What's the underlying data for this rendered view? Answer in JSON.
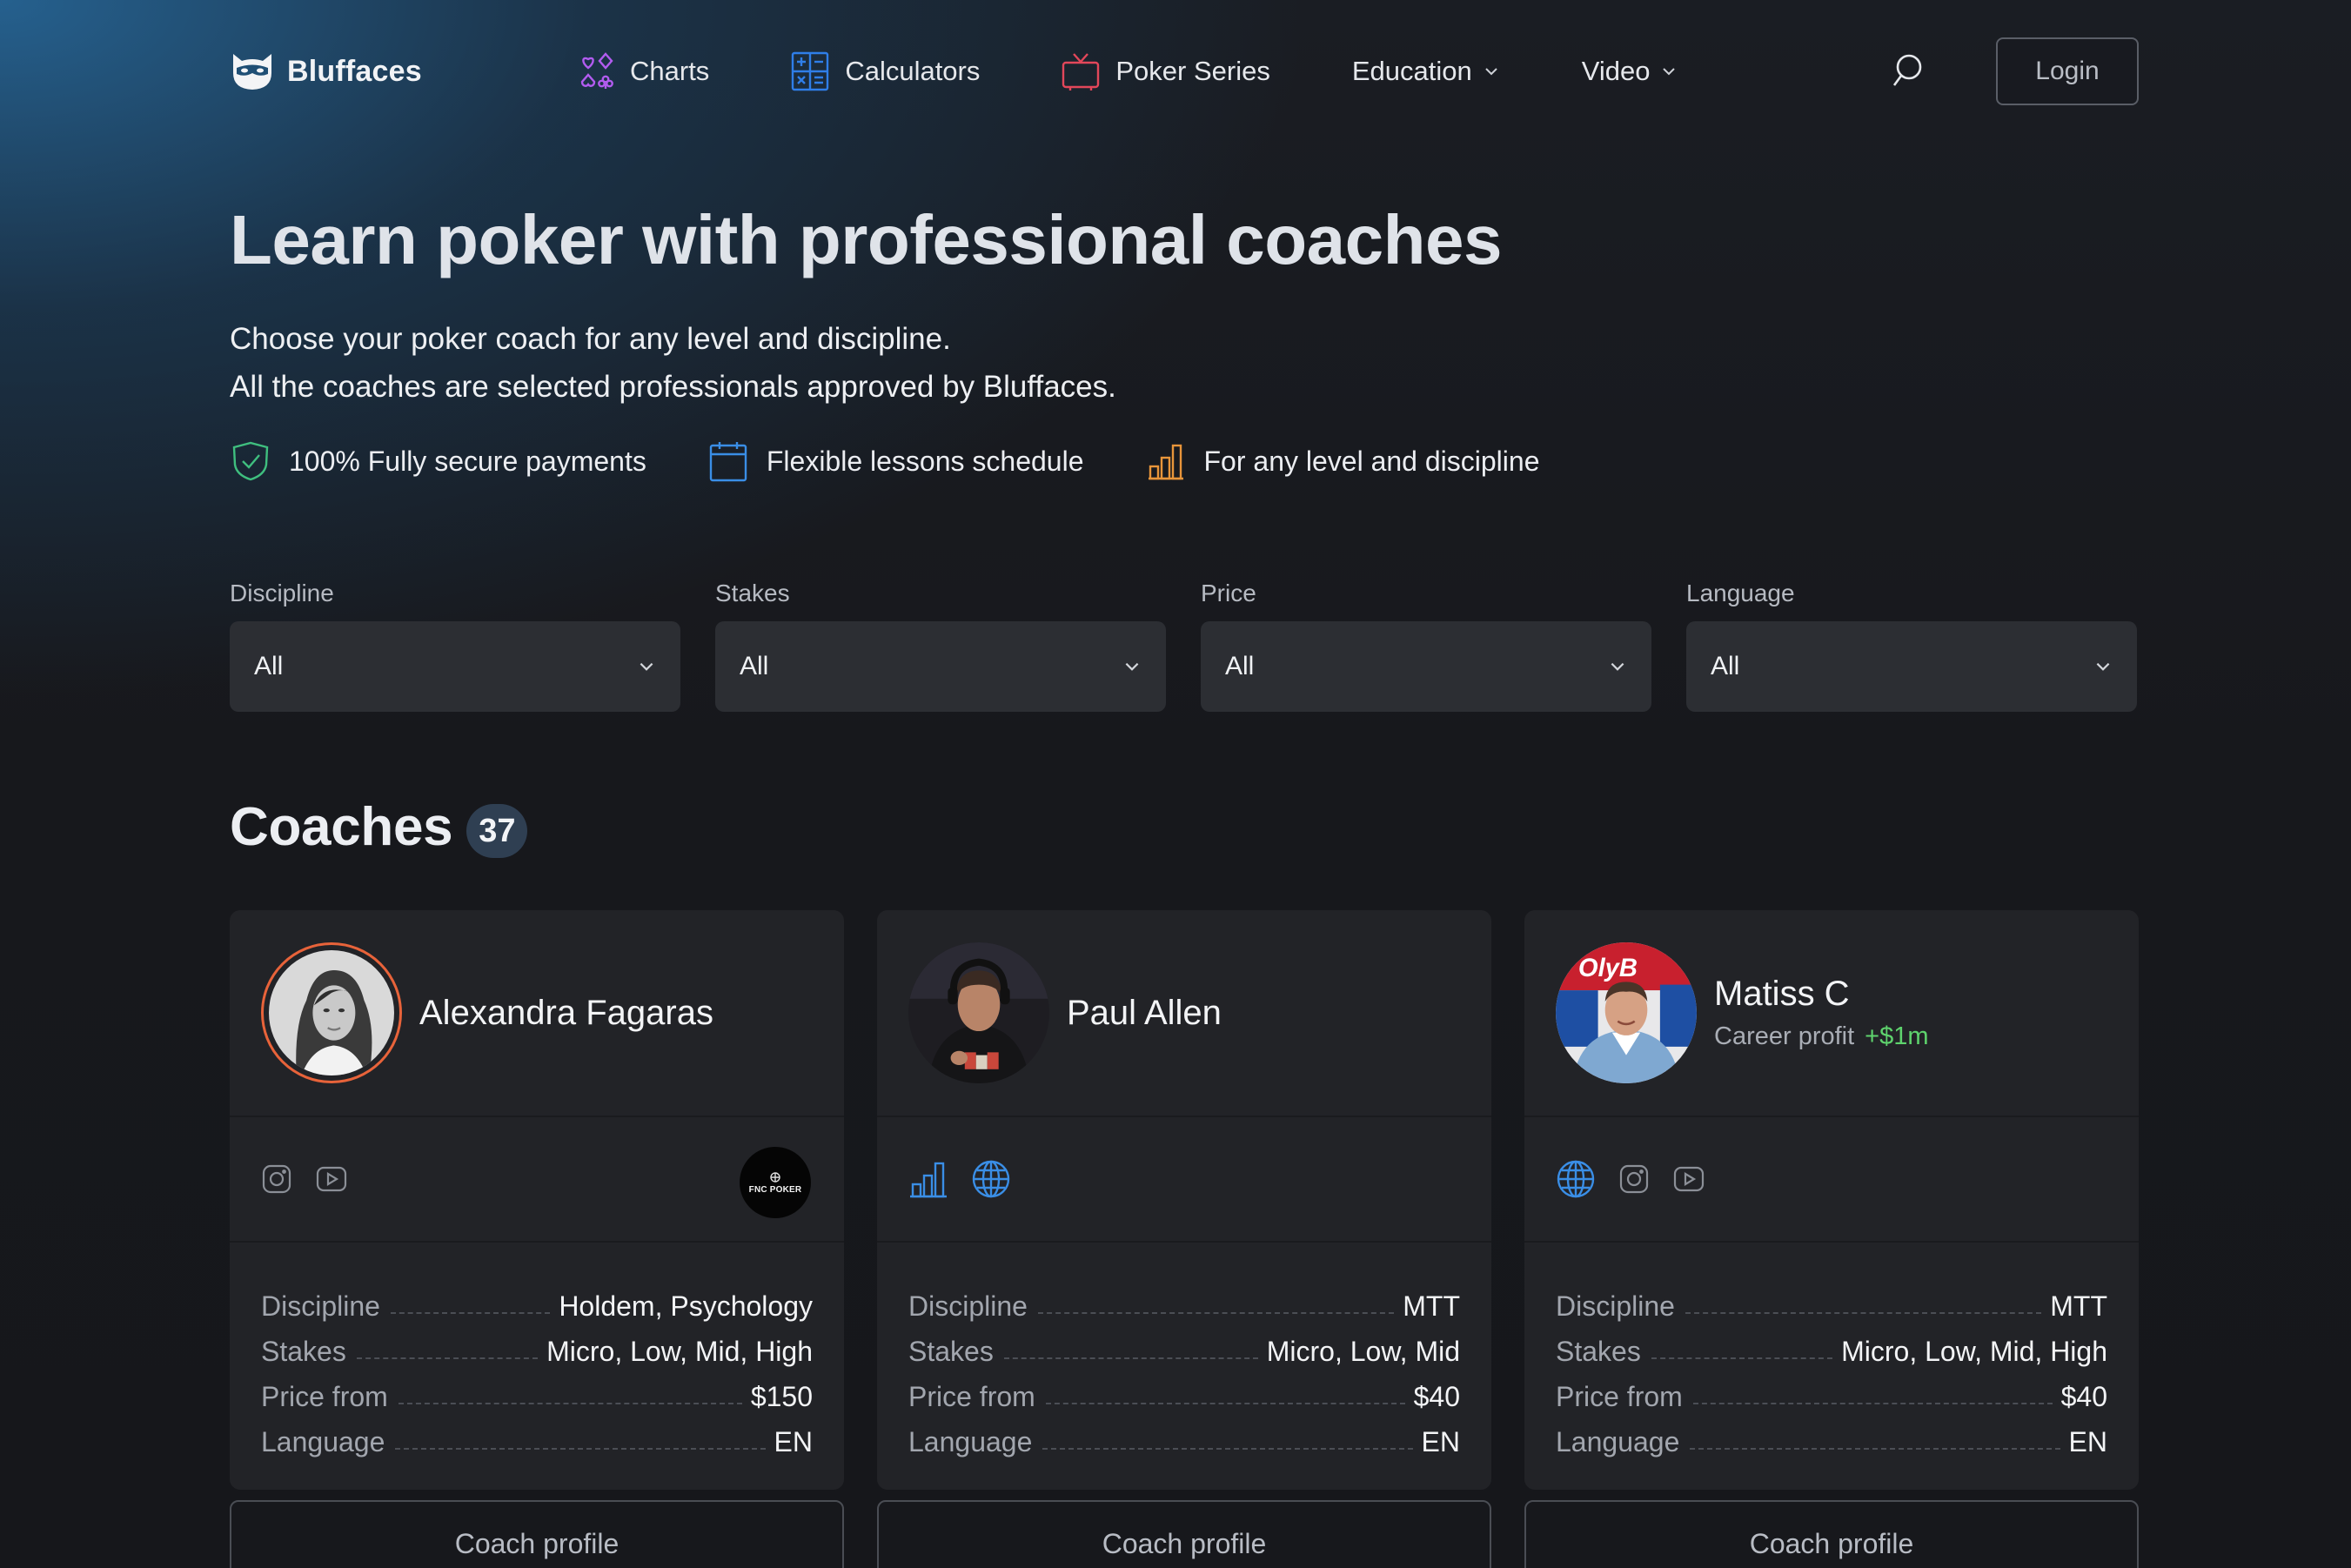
{
  "brand": {
    "name": "Bluffaces",
    "icon": "mask-icon"
  },
  "nav": {
    "items": [
      {
        "label": "Charts",
        "icon": "cards-suits-icon",
        "color": "#b25cf0"
      },
      {
        "label": "Calculators",
        "icon": "calculator-icon",
        "color": "#2f7ee8"
      },
      {
        "label": "Poker Series",
        "icon": "tv-icon",
        "color": "#e2475a"
      },
      {
        "label": "Education",
        "icon": "chevron-down-icon"
      },
      {
        "label": "Video",
        "icon": "chevron-down-icon"
      }
    ],
    "search_icon": "search-icon",
    "login_label": "Login"
  },
  "hero": {
    "title": "Learn poker with professional coaches",
    "subtitle_line1": "Choose your poker coach for any level and discipline.",
    "subtitle_line2": "All the coaches are selected professionals approved by Bluffaces.",
    "features": [
      {
        "label": "100% Fully secure payments",
        "icon": "shield-check-icon",
        "color": "#3fbf7f"
      },
      {
        "label": "Flexible lessons schedule",
        "icon": "calendar-icon",
        "color": "#3a8ee6"
      },
      {
        "label": "For any level and discipline",
        "icon": "bar-chart-icon",
        "color": "#e8953a"
      }
    ]
  },
  "filters": [
    {
      "label": "Discipline",
      "value": "All"
    },
    {
      "label": "Stakes",
      "value": "All"
    },
    {
      "label": "Price",
      "value": "All"
    },
    {
      "label": "Language",
      "value": "All"
    }
  ],
  "coaches": {
    "title": "Coaches",
    "count": "37",
    "cards": [
      {
        "name": "Alexandra Fagaras",
        "career_label": "",
        "career_profit": "",
        "social": [
          "instagram-icon",
          "youtube-icon"
        ],
        "sponsor_text": "FNC POKER",
        "rows": [
          {
            "key": "Discipline",
            "value": "Holdem, Psychology"
          },
          {
            "key": "Stakes",
            "value": "Micro, Low, Mid, High"
          },
          {
            "key": "Price from",
            "value": "$150"
          },
          {
            "key": "Language",
            "value": "EN"
          }
        ],
        "button": "Coach profile"
      },
      {
        "name": "Paul Allen",
        "career_label": "",
        "career_profit": "",
        "social": [
          "stats-icon",
          "globe-icon"
        ],
        "rows": [
          {
            "key": "Discipline",
            "value": "MTT"
          },
          {
            "key": "Stakes",
            "value": "Micro, Low, Mid"
          },
          {
            "key": "Price from",
            "value": "$40"
          },
          {
            "key": "Language",
            "value": "EN"
          }
        ],
        "button": "Coach profile"
      },
      {
        "name": "Matiss C",
        "career_label": "Career profit",
        "career_profit": "+$1m",
        "avatar_banner_text": "OlyB",
        "social": [
          "globe-icon",
          "instagram-icon",
          "youtube-icon"
        ],
        "rows": [
          {
            "key": "Discipline",
            "value": "MTT"
          },
          {
            "key": "Stakes",
            "value": "Micro, Low, Mid, High"
          },
          {
            "key": "Price from",
            "value": "$40"
          },
          {
            "key": "Language",
            "value": "EN"
          }
        ],
        "button": "Coach profile"
      }
    ]
  }
}
